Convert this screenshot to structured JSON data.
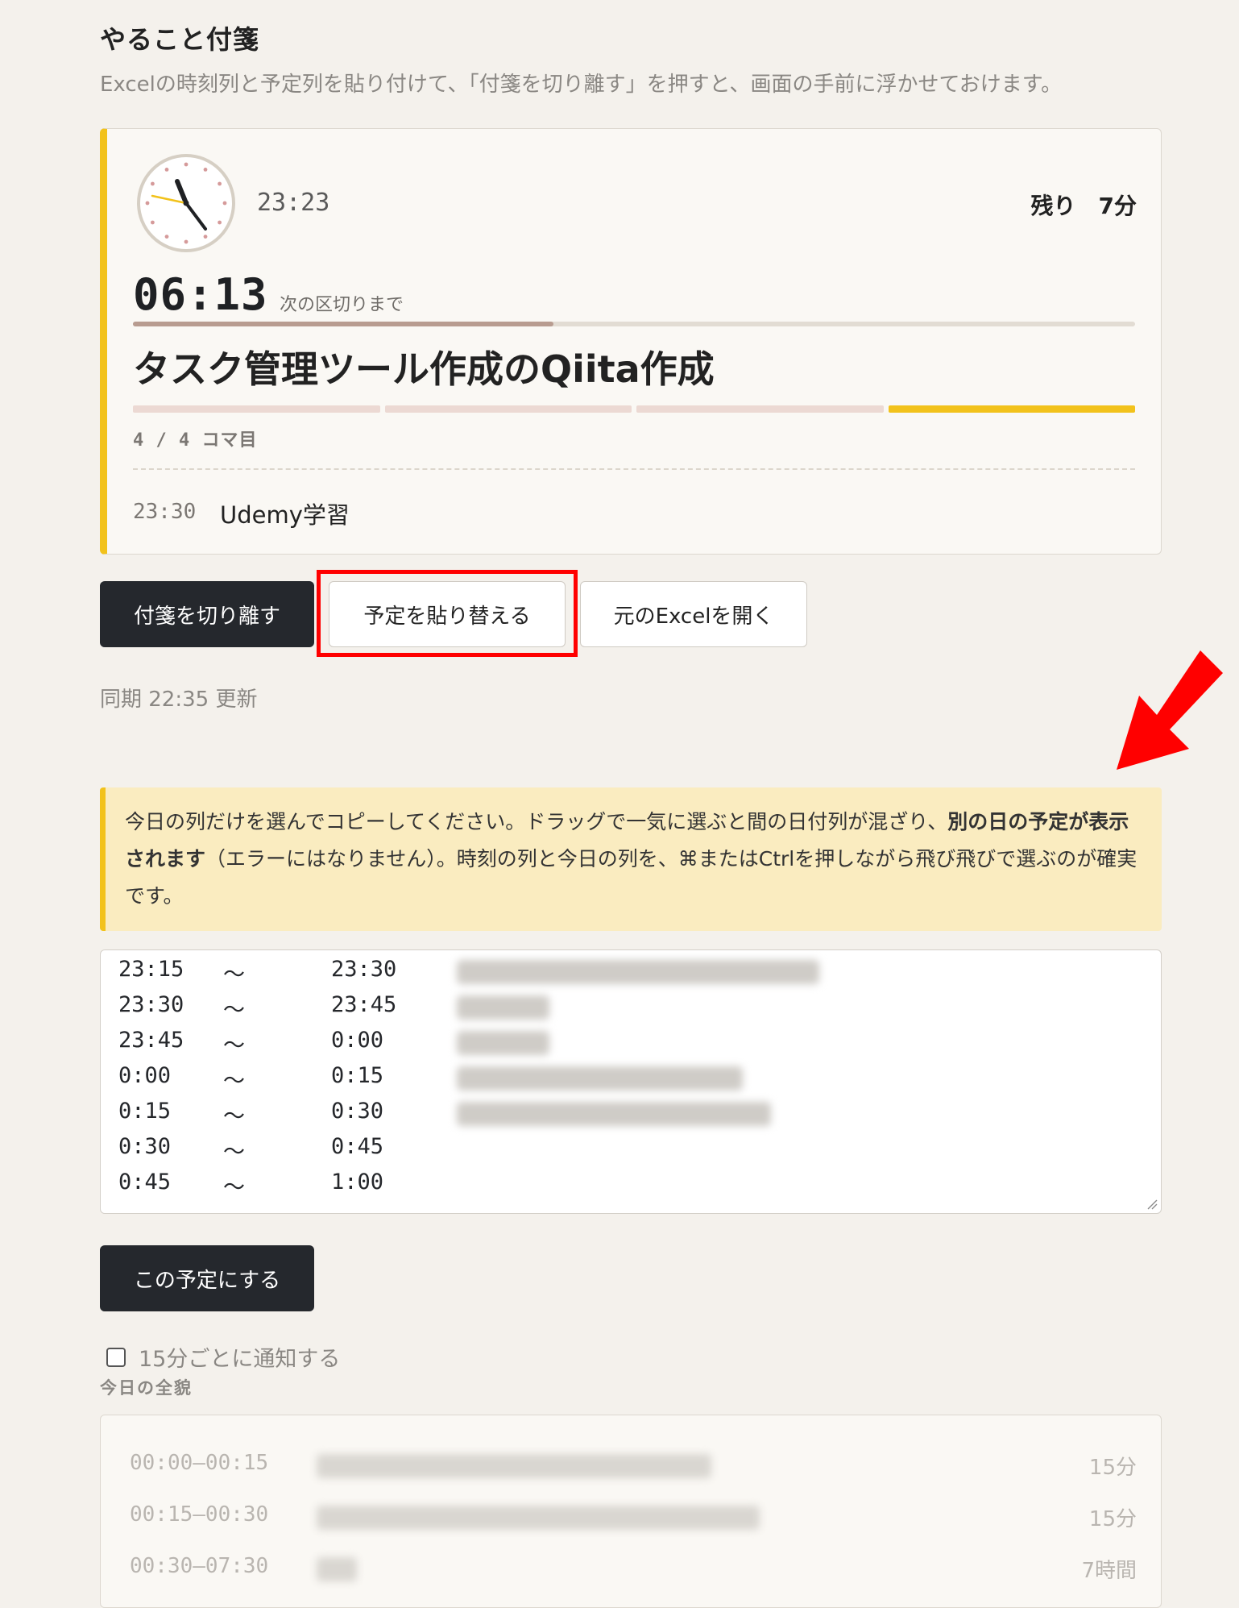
{
  "header": {
    "title": "やること付箋",
    "description": "Excelの時刻列と予定列を貼り付けて、「付箋を切り離す」を押すと、画面の手前に浮かせておけます。"
  },
  "card": {
    "clock_time": "23:23",
    "remaining": "残り　7分",
    "countdown": "06:13",
    "countdown_label": "次の区切りまで",
    "progress_fraction": 0.42,
    "task_title": "タスク管理ツール作成のQiita作成",
    "segments": [
      false,
      false,
      false,
      true
    ],
    "koma": "4 / 4 コマ目",
    "next_time": "23:30",
    "next_task": "Udemy学習"
  },
  "actions": {
    "detach_label": "付箋を切り離す",
    "replace_label": "予定を貼り替える",
    "open_excel_label": "元のExcelを開く",
    "sync_text": "同期 22:35 更新"
  },
  "notice": {
    "text_1": "今日の列だけを選んでコピーしてください。ドラッグで一気に選ぶと間の日付列が混ざり、",
    "bold": "別の日の予定が表示されます",
    "text_2": "（エラーにはなりません）。時刻の列と今日の列を、⌘またはCtrlを押しながら飛び飛びで選ぶのが確実です。"
  },
  "schedule": {
    "rows": [
      {
        "start": "23:15",
        "sep": "〜",
        "end": "23:30"
      },
      {
        "start": "23:30",
        "sep": "〜",
        "end": "23:45"
      },
      {
        "start": "23:45",
        "sep": "〜",
        "end": "0:00"
      },
      {
        "start": "0:00",
        "sep": "〜",
        "end": "0:15"
      },
      {
        "start": "0:15",
        "sep": "〜",
        "end": "0:30"
      },
      {
        "start": "0:30",
        "sep": "〜",
        "end": "0:45"
      },
      {
        "start": "0:45",
        "sep": "〜",
        "end": "1:00"
      }
    ]
  },
  "apply_label": "この予定にする",
  "notify_label": "15分ごとに通知する",
  "overview": {
    "title": "今日の全貌",
    "rows": [
      {
        "time": "00:00–00:15",
        "duration": "15分"
      },
      {
        "time": "00:15–00:30",
        "duration": "15分"
      },
      {
        "time": "00:30–07:30",
        "duration": "7時間"
      }
    ]
  },
  "colors": {
    "accent": "#f2c21b",
    "highlight": "#ff0000",
    "dark_button": "#25282d"
  }
}
